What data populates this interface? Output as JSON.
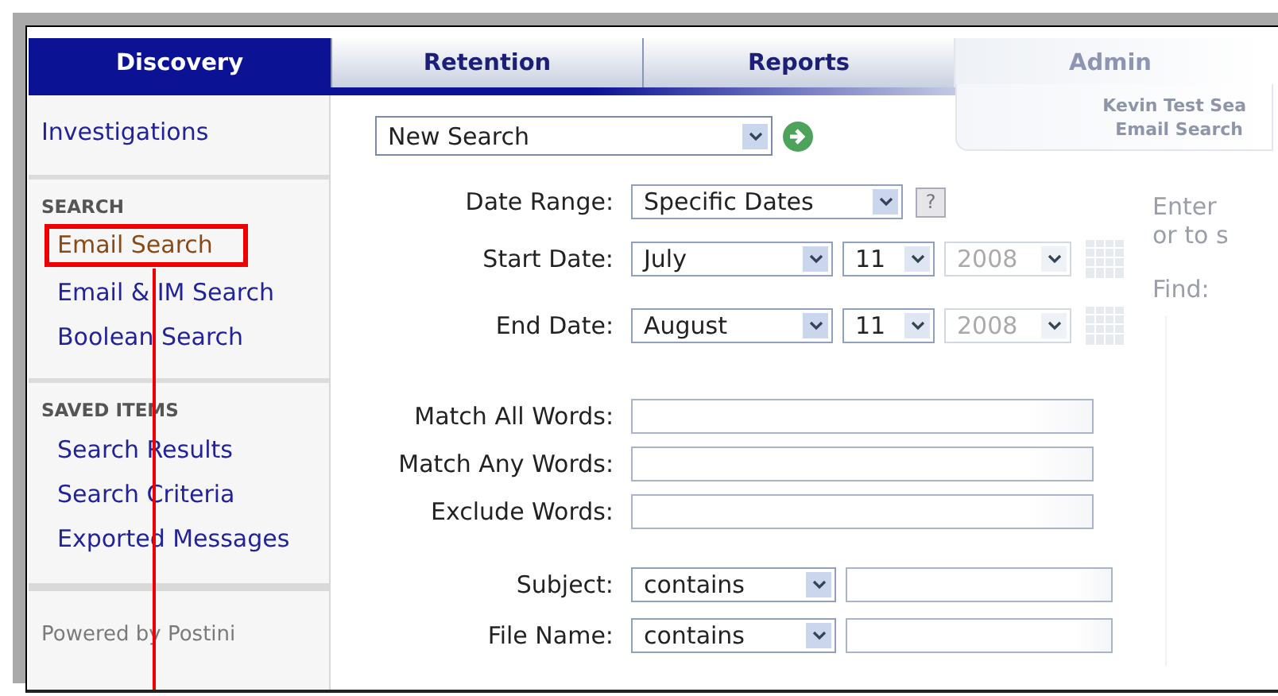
{
  "tabs": [
    {
      "label": "Discovery",
      "selected": true
    },
    {
      "label": "Retention",
      "selected": false
    },
    {
      "label": "Reports",
      "selected": false
    },
    {
      "label": "Admin",
      "selected": false
    }
  ],
  "sidebar": {
    "sections": [
      {
        "items": [
          {
            "label": "Investigations",
            "highlighted": false
          }
        ]
      },
      {
        "heading": "SEARCH",
        "items": [
          {
            "label": "Email Search",
            "highlighted": true
          },
          {
            "label": "Email & IM Search",
            "highlighted": false
          },
          {
            "label": "Boolean Search",
            "highlighted": false
          }
        ]
      },
      {
        "heading": "SAVED ITEMS",
        "items": [
          {
            "label": "Search Results",
            "highlighted": false
          },
          {
            "label": "Search Criteria",
            "highlighted": false
          },
          {
            "label": "Exported Messages",
            "highlighted": false
          }
        ]
      }
    ],
    "footer": "Powered by Postini"
  },
  "search_select": {
    "value": "New Search"
  },
  "saved_panel": {
    "title": "Kevin Test Sea",
    "subtitle": "Email Search"
  },
  "side_hint": {
    "lines": [
      "Enter",
      "or to s"
    ],
    "find_label": "Find:"
  },
  "form": [
    {
      "label": "Date Range:",
      "kind": "range",
      "value": "Specific Dates",
      "help": "?"
    },
    {
      "label": "Start Date:",
      "kind": "date",
      "month": "July",
      "day": "11",
      "year": "2008",
      "year_disabled": true
    },
    {
      "label": "End Date:",
      "kind": "date",
      "month": "August",
      "day": "11",
      "year": "2008",
      "year_disabled": true
    },
    {
      "label": "Match All Words:",
      "kind": "text"
    },
    {
      "label": "Match Any Words:",
      "kind": "text"
    },
    {
      "label": "Exclude Words:",
      "kind": "text"
    },
    {
      "label": "Subject:",
      "kind": "match",
      "operator": "contains"
    },
    {
      "label": "File Name:",
      "kind": "match",
      "operator": "contains"
    }
  ]
}
